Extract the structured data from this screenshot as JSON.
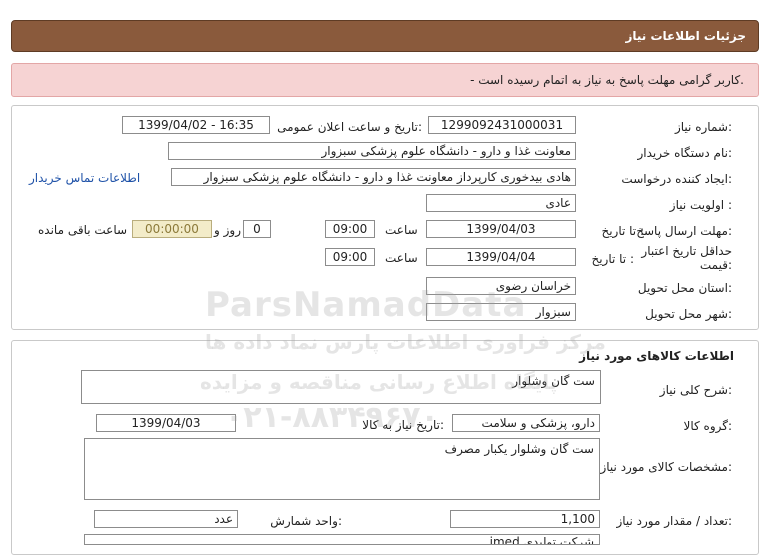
{
  "header": {
    "title": "جزئیات اطلاعات نیاز"
  },
  "alert": {
    "text": "- کاربر گرامی مهلت پاسخ به نیاز به اتمام رسیده است."
  },
  "info": {
    "need_number_label": "شماره نیاز:",
    "need_number": "1299092431000031",
    "announce_label": "تاریخ و ساعت اعلان عمومی:",
    "announce_value": "1399/04/02 - 16:35",
    "buyer_label": "نام دستگاه خریدار:",
    "buyer_value": "معاونت غذا و دارو - دانشگاه علوم پزشکی سبزوار",
    "creator_label": "ایجاد کننده درخواست:",
    "creator_value": "هادی بیدخوری کارپرداز معاونت غذا و دارو - دانشگاه علوم پزشکی سبزوار",
    "contact_link": "اطلاعات تماس خریدار",
    "priority_label": "اولویت نیاز :",
    "priority_value": "عادی",
    "deadline_label": "مهلت ارسال پاسخ:",
    "to_date_label": "تا تاریخ :",
    "deadline_date": "1399/04/03",
    "time_label": "ساعت",
    "deadline_time": "09:00",
    "days_value": "0",
    "days_label": "روز و",
    "remaining_value": "00:00:00",
    "remaining_label": "ساعت باقی مانده",
    "validity_label_1": "حداقل تاریخ اعتبار",
    "validity_label_2": "قیمت:",
    "validity_to_label": "تا تاریخ :",
    "validity_date": "1399/04/04",
    "validity_time_label": "ساعت",
    "validity_time": "09:00",
    "province_label": "استان محل تحویل:",
    "province_value": "خراسان رضوی",
    "city_label": "شهر محل تحویل:",
    "city_value": "سبزوار"
  },
  "goods": {
    "section_title": "اطلاعات کالاهای مورد نیاز",
    "summary_label": "شرح کلی نیاز:",
    "summary_value": "ست گان وشلوار",
    "group_label": "گروه کالا:",
    "group_value": "دارو، پزشکی و سلامت",
    "need_date_label": "تاریخ نیاز به کالا:",
    "need_date_value": "1399/04/03",
    "spec_label": "مشخصات کالای مورد نیاز:",
    "spec_value": "ست گان وشلوار یکبار مصرف",
    "qty_label": "تعداد / مقدار مورد نیاز:",
    "qty_value": "1,100",
    "unit_label": "واحد شمارش:",
    "unit_value": "عدد",
    "bottom_value": "شرکت تولیدی imed"
  },
  "watermark": {
    "line1": "ParsNamadData",
    "line2": "مرکز فراوری اطلاعات پارس نماد داده ها",
    "line3": "پایگاه اطلاع رسانی مناقصه و مزایده",
    "line4": "۰۲۱-۸۸۳۴۹۶۷۰"
  }
}
